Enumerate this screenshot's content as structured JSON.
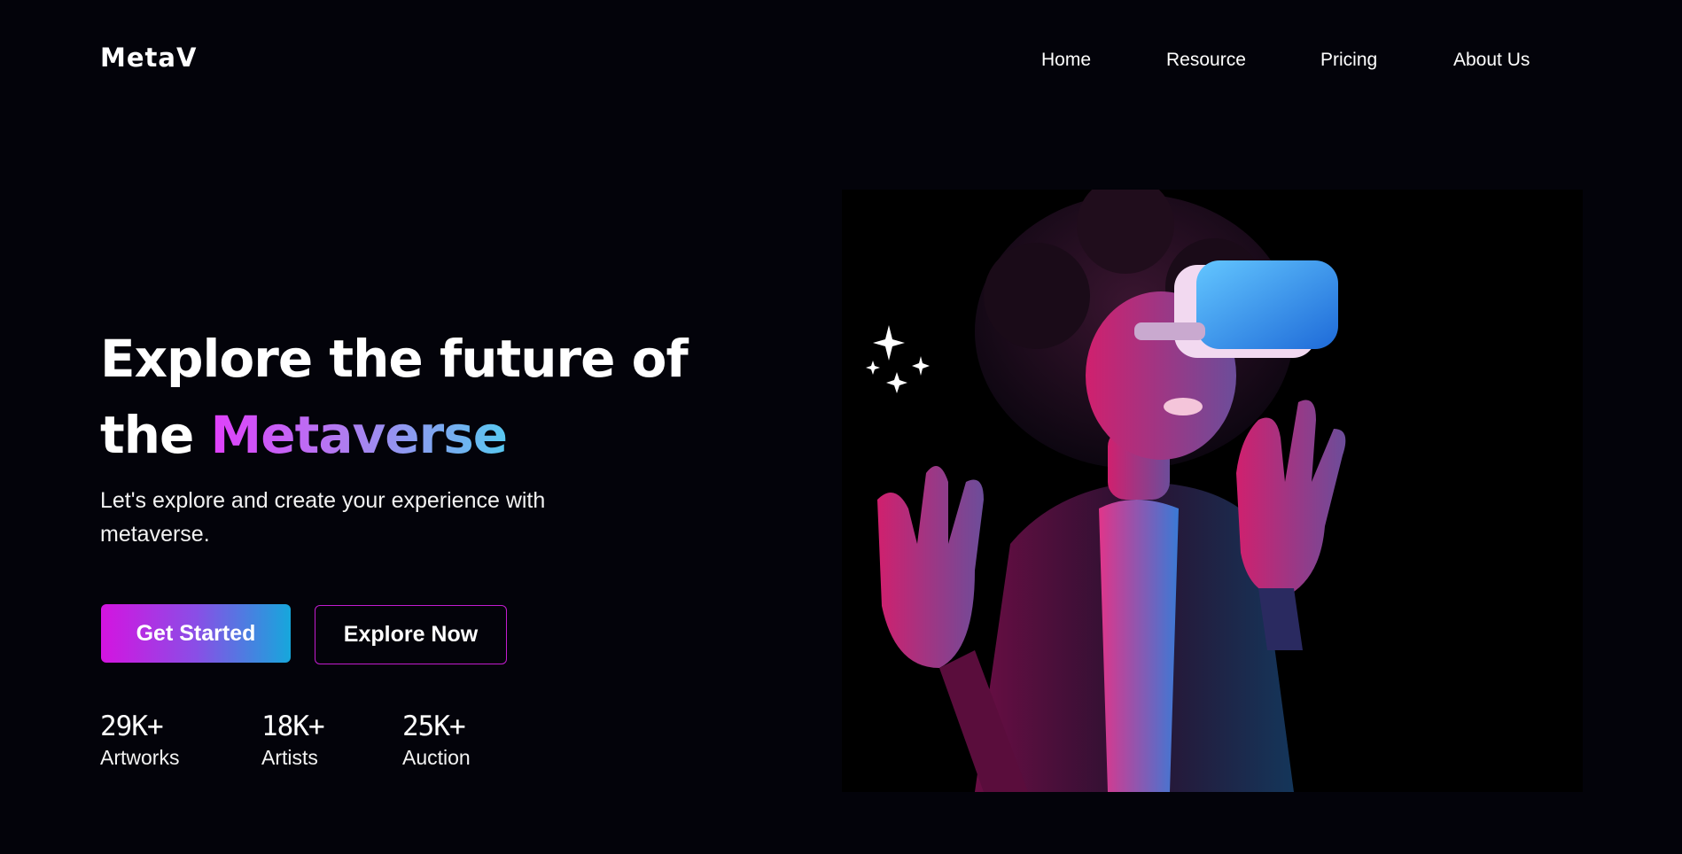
{
  "brand": {
    "logo": "MetaV"
  },
  "nav": {
    "items": [
      "Home",
      "Resource",
      "Pricing",
      "About Us"
    ]
  },
  "hero": {
    "headline_line1": "Explore the future of",
    "headline_prefix": "the ",
    "headline_highlight": "Metaverse",
    "subtitle": "Let's explore and create your experience with metaverse.",
    "primary_button": "Get Started",
    "secondary_button": "Explore Now"
  },
  "stats": [
    {
      "value": "29K+",
      "label": "Artworks"
    },
    {
      "value": "18K+",
      "label": "Artists"
    },
    {
      "value": "25K+",
      "label": "Auction"
    }
  ],
  "colors": {
    "background": "#03030a",
    "gradient_pink": "#d414e0",
    "gradient_blue": "#16a7dc",
    "outline_border": "#c21ccf"
  },
  "icons": [
    "sparkles-icon"
  ]
}
